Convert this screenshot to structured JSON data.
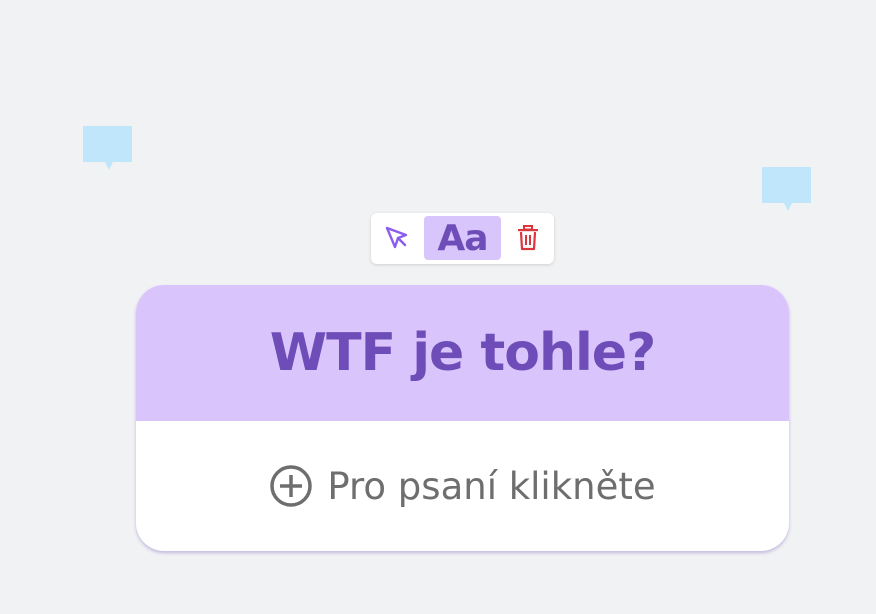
{
  "toolbar": {
    "select_icon": "cursor-arrow-icon",
    "text_label": "Aa",
    "delete_icon": "trash-icon"
  },
  "card": {
    "title": "WTF je tohle?",
    "placeholder_icon": "plus-circle-icon",
    "placeholder": "Pro psaní klikněte"
  },
  "colors": {
    "background": "#f1f2f4",
    "accent": "#6f4db8",
    "header_fill": "#d9c5fc",
    "tooltip": "#bfe6fb",
    "delete": "#d9363e"
  }
}
